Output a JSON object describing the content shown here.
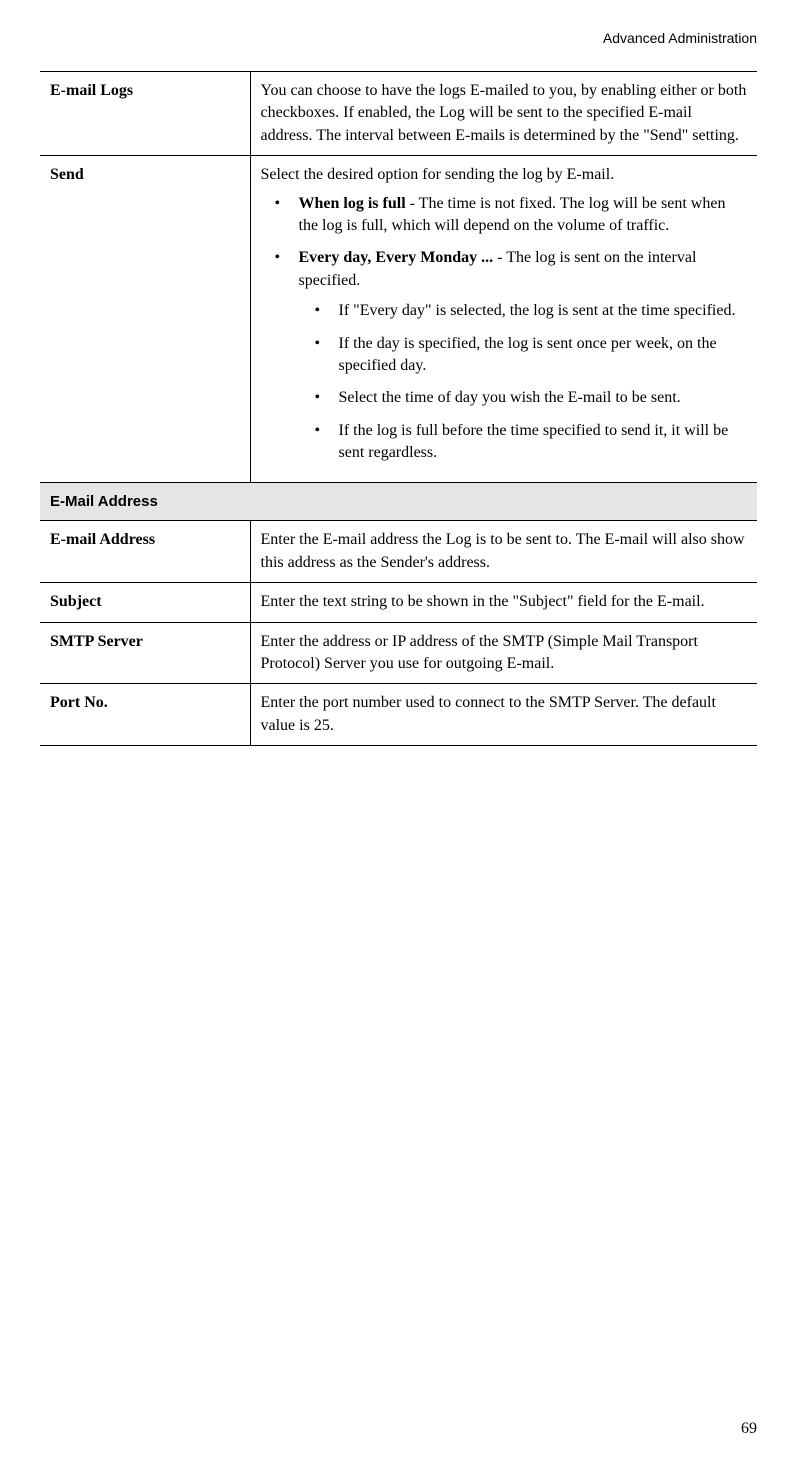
{
  "header": "Advanced Administration",
  "page_number": "69",
  "rows": {
    "email_logs": {
      "label": "E-mail Logs",
      "desc": "You can choose to have the logs E-mailed to you, by enabling either or both checkboxes. If enabled, the Log will be sent to the specified E-mail address. The interval between E-mails is determined by the \"Send\" setting."
    },
    "send": {
      "label": "Send",
      "intro": "Select the desired option for sending the log by E-mail.",
      "bullets": {
        "when_log_full": {
          "bold": "When log is full",
          "rest": " - The time is not fixed. The log will be sent when the log is full, which will depend on the volume of traffic."
        },
        "every_day": {
          "bold": "Every day, Every Monday ...",
          "rest": "  - The log is sent on the interval specified.",
          "sub": {
            "s1": "If \"Every day\" is selected, the log is sent at the time specified.",
            "s2": "If the day is specified, the log is sent once per week, on the specified day.",
            "s3": "Select the time of day you wish the E-mail to be sent.",
            "s4": "If the log is full before the time specified to send it, it will be sent regardless."
          }
        }
      }
    },
    "section_email_address": "E-Mail Address",
    "email_address": {
      "label": "E-mail Address",
      "desc": "Enter the E-mail address the Log is to be sent to. The E-mail will also show this address as the Sender's address."
    },
    "subject": {
      "label": "Subject",
      "desc": "Enter the text string to be shown in the \"Subject\" field for the E-mail."
    },
    "smtp_server": {
      "label": "SMTP Server",
      "desc": "Enter the address or IP address of the SMTP (Simple Mail Transport Protocol) Server you use for outgoing E-mail."
    },
    "port_no": {
      "label": "Port No.",
      "desc": "Enter the port number used to connect to the SMTP Server. The default value is 25."
    }
  }
}
